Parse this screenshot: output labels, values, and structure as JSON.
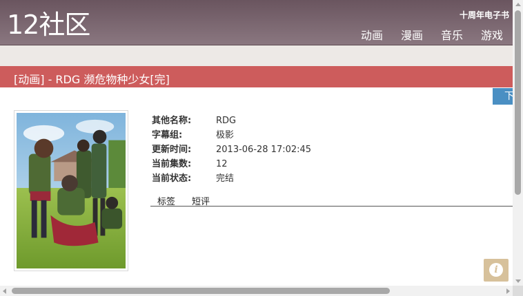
{
  "header": {
    "logo": "12社区",
    "tagline": "十周年电子书",
    "nav": [
      "动画",
      "漫画",
      "音乐",
      "游戏"
    ]
  },
  "title_bar": {
    "title": "[动画] - RDG 濒危物种少女[完]"
  },
  "download_tab": {
    "label": "下"
  },
  "info": {
    "rows": [
      {
        "label": "其他名称:",
        "value": "RDG"
      },
      {
        "label": "字幕组:",
        "value": "极影"
      },
      {
        "label": "更新时间:",
        "value": "2013-06-28 17:02:45"
      },
      {
        "label": "当前集数:",
        "value": "12"
      },
      {
        "label": "当前状态:",
        "value": "完结"
      }
    ]
  },
  "tabs": [
    "标签",
    "短评"
  ],
  "info_button": {
    "glyph": "i"
  },
  "colors": {
    "header_bg": "#7a6670",
    "title_bar_bg": "#cd5c5c",
    "download_tab_bg": "#4a8fc3",
    "info_button_bg": "#d7c19b"
  }
}
